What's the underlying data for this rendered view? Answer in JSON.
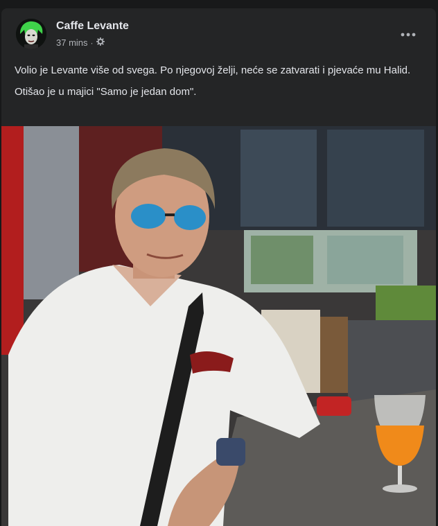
{
  "post": {
    "page_name": "Caffe Levante",
    "timestamp": "37 mins",
    "separator": "·",
    "privacy_icon": "gear-icon",
    "more_icon": "more-horizontal-icon",
    "paragraphs": [
      "Volio je Levante više od svega. Po njegovoj želji, neće se zatvarati i pjevaće mu Halid.",
      "Otišao je u majici \"Samo je jedan dom\"."
    ]
  },
  "colors": {
    "background": "#18191a",
    "card": "#242526",
    "primary_text": "#e4e6eb",
    "secondary_text": "#b0b3b8"
  }
}
